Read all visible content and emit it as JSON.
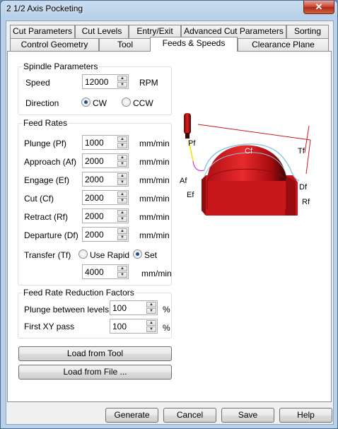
{
  "window": {
    "title": "2 1/2 Axis Pocketing",
    "close_glyph": "✕"
  },
  "tabs_row1": [
    "Cut Parameters",
    "Cut Levels",
    "Entry/Exit",
    "Advanced Cut Parameters",
    "Sorting"
  ],
  "tabs_row2": [
    "Control Geometry",
    "Tool",
    "Feeds & Speeds",
    "Clearance Plane"
  ],
  "active_tab": "Feeds & Speeds",
  "spindle": {
    "title": "Spindle Parameters",
    "speed_label": "Speed",
    "speed_value": "12000",
    "speed_unit": "RPM",
    "direction_label": "Direction",
    "cw_label": "CW",
    "ccw_label": "CCW",
    "direction_selected": "CW"
  },
  "feed_rates": {
    "title": "Feed Rates",
    "rows": [
      {
        "label": "Plunge (Pf)",
        "value": "1000",
        "unit": "mm/min"
      },
      {
        "label": "Approach (Af)",
        "value": "2000",
        "unit": "mm/min"
      },
      {
        "label": "Engage (Ef)",
        "value": "2000",
        "unit": "mm/min"
      },
      {
        "label": "Cut (Cf)",
        "value": "2000",
        "unit": "mm/min"
      },
      {
        "label": "Retract (Rf)",
        "value": "2000",
        "unit": "mm/min"
      },
      {
        "label": "Departure  (Df)",
        "value": "2000",
        "unit": "mm/min"
      }
    ],
    "transfer_label": "Transfer (Tf)",
    "use_rapid_label": "Use Rapid",
    "set_label": "Set",
    "transfer_selected": "Set",
    "transfer_value": "4000",
    "transfer_unit": "mm/min"
  },
  "reduction": {
    "title": "Feed Rate Reduction Factors",
    "plunge_label": "Plunge between levels",
    "plunge_value": "100",
    "first_xy_label": "First XY pass",
    "first_xy_value": "100",
    "unit": "%"
  },
  "buttons": {
    "load_tool": "Load from Tool",
    "load_file": "Load from File ...",
    "generate": "Generate",
    "cancel": "Cancel",
    "save": "Save",
    "help": "Help"
  },
  "preview_labels": {
    "pf": "Pf",
    "cf": "Cf",
    "tf": "Tf",
    "af": "Af",
    "ef": "Ef",
    "df": "Df",
    "rf": "Rf"
  },
  "colors": {
    "part": "#c8171a",
    "toolpath": "#8ec5e6",
    "tool_tip": "#d01818",
    "approach": "#e8e800",
    "engage": "#d040d0"
  }
}
